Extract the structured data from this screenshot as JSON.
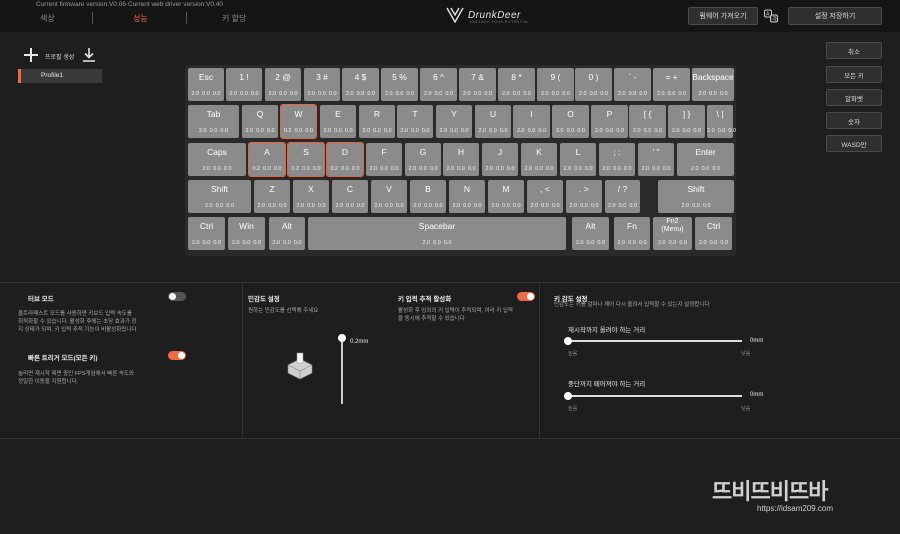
{
  "header": {
    "firmware_version": "Current firmware version:V0.06",
    "driver_version": "Current web driver version:V0.40",
    "tabs": [
      {
        "label": "색상",
        "active": false
      },
      {
        "label": "성능",
        "active": true
      },
      {
        "label": "키 할당",
        "active": false
      }
    ],
    "logo_text": "DrunkDeer",
    "logo_sub": "UNLEASH YOUR POTENTIAL",
    "import_button": "펌웨어 가져오기",
    "save_button": "설정 저장하기",
    "lang_icon": "translate-icon"
  },
  "profiles": {
    "create_label": "프로필 생성",
    "items": [
      "Profile1"
    ]
  },
  "side_buttons": [
    "취소",
    "모든 키",
    "알파벳",
    "숫자",
    "WASD만"
  ],
  "keyboard": {
    "rows": [
      [
        {
          "label": "Esc",
          "value": "2.0  0.0  0.0"
        },
        {
          "label": "1 !",
          "value": "2.0  0.0  0.0"
        },
        {
          "label": "2 @",
          "value": "2.0  0.0  0.0"
        },
        {
          "label": "3 #",
          "value": "2.0  0.0  0.0"
        },
        {
          "label": "4 $",
          "value": "2.0  0.0  0.0"
        },
        {
          "label": "5 %",
          "value": "2.0  0.0  0.0"
        },
        {
          "label": "6 ^",
          "value": "2.0  0.0  0.0"
        },
        {
          "label": "7 &",
          "value": "2.0  0.0  0.0"
        },
        {
          "label": "8 *",
          "value": "2.0  0.0  0.0"
        },
        {
          "label": "9 (",
          "value": "2.0  0.0  0.0"
        },
        {
          "label": "0 )",
          "value": "2.0  0.0  0.0"
        },
        {
          "label": "` -",
          "value": "2.0  0.0  0.0"
        },
        {
          "label": "= +",
          "value": "2.0  0.0  0.0"
        },
        {
          "label": "Backspace",
          "value": "2.0  0.0  0.0"
        }
      ],
      [
        {
          "label": "Tab",
          "value": "2.0  0.0  0.0"
        },
        {
          "label": "Q",
          "value": "2.0  0.0  0.0"
        },
        {
          "label": "W",
          "value": "0.2  0.0  0.0",
          "selected": true
        },
        {
          "label": "E",
          "value": "2.0  0.0  0.0"
        },
        {
          "label": "R",
          "value": "2.0  0.0  0.0"
        },
        {
          "label": "T",
          "value": "2.0  0.0  0.0"
        },
        {
          "label": "Y",
          "value": "2.0  0.0  0.0"
        },
        {
          "label": "U",
          "value": "2.0  0.0  0.0"
        },
        {
          "label": "I",
          "value": "2.0  0.0  0.0"
        },
        {
          "label": "O",
          "value": "2.0  0.0  0.0"
        },
        {
          "label": "P",
          "value": "2.0  0.0  0.0"
        },
        {
          "label": "[ {",
          "value": "2.0  0.0  0.0"
        },
        {
          "label": "] }",
          "value": "2.0  0.0  0.0"
        },
        {
          "label": "\\ |",
          "value": "2.0  0.0  0.0"
        }
      ],
      [
        {
          "label": "Caps",
          "value": "2.0  0.0  0.0"
        },
        {
          "label": "A",
          "value": "0.2  0.0  0.0",
          "selected": true
        },
        {
          "label": "S",
          "value": "0.2  0.0  0.0",
          "selected": true
        },
        {
          "label": "D",
          "value": "0.2  0.0  0.0",
          "selected": true
        },
        {
          "label": "F",
          "value": "2.0  0.0  0.0"
        },
        {
          "label": "G",
          "value": "2.0  0.0  0.0"
        },
        {
          "label": "H",
          "value": "2.0  0.0  0.0"
        },
        {
          "label": "J",
          "value": "2.0  0.0  0.0"
        },
        {
          "label": "K",
          "value": "2.0  0.0  0.0"
        },
        {
          "label": "L",
          "value": "2.0  0.0  0.0"
        },
        {
          "label": "; :",
          "value": "2.0  0.0  0.0"
        },
        {
          "label": "' \"",
          "value": "2.0  0.0  0.0"
        },
        {
          "label": "Enter",
          "value": "2.0  0.0  0.0"
        }
      ],
      [
        {
          "label": "Shift",
          "value": "2.0  0.0  0.0"
        },
        {
          "label": "Z",
          "value": "2.0  0.0  0.0"
        },
        {
          "label": "X",
          "value": "2.0  0.0  0.0"
        },
        {
          "label": "C",
          "value": "2.0  0.0  0.0"
        },
        {
          "label": "V",
          "value": "2.0  0.0  0.0"
        },
        {
          "label": "B",
          "value": "2.0  0.0  0.0"
        },
        {
          "label": "N",
          "value": "2.0  0.0  0.0"
        },
        {
          "label": "M",
          "value": "2.0  0.0  0.0"
        },
        {
          "label": ", <",
          "value": "2.0  0.0  0.0"
        },
        {
          "label": ". >",
          "value": "2.0  0.0  0.0"
        },
        {
          "label": "/ ?",
          "value": "2.0  0.0  0.0"
        },
        {
          "label": "Shift",
          "value": "2.0  0.0  0.0"
        }
      ],
      [
        {
          "label": "Ctrl",
          "value": "2.0  0.0  0.0"
        },
        {
          "label": "Win",
          "value": "2.0  0.0  0.0"
        },
        {
          "label": "Alt",
          "value": "2.0  0.0  0.0"
        },
        {
          "label": "Spacebar",
          "value": "2.0  0.0  0.0"
        },
        {
          "label": "Alt",
          "value": "2.0  0.0  0.0"
        },
        {
          "label": "Fn",
          "value": "2.0  0.0  0.0"
        },
        {
          "label": "Fn2\n(Menu)",
          "value": "2.0  0.0  0.0"
        },
        {
          "label": "Ctrl",
          "value": "2.0  0.0  0.0"
        }
      ]
    ]
  },
  "turbo": {
    "title": "터보 모드",
    "enabled": false,
    "desc1": "울트라패스트 모드를 사용하면 키보드 입력 속도를",
    "desc2": "최적화할 수 있습니다. 활성화 후에는 초당 효과가 정",
    "desc3": "지 상태가 되며, 키 입력 추적 기능이 비활성화됩니다"
  },
  "rapid_trigger": {
    "title": "빠른 트리거 모드(모든 키)",
    "enabled": true,
    "desc1": "눌리면 재시작 제면 중인 FPS게임에서 빠른 속도와",
    "desc2": "정밀한 이동을 지원합니다."
  },
  "sensitivity": {
    "title": "민감도 설정",
    "desc": "원하는 민감도를 선택해 주세요",
    "value_label": "0.2mm"
  },
  "key_tracking": {
    "title": "키 입력 추적 활성화",
    "enabled": true,
    "desc1": "활성화 후 임의의 키 입력이 추적되며, 여러 키 입력",
    "desc2": "을 동시에 추적할 수 있습니다"
  },
  "key_sensitivity": {
    "title": "키 감도 설정",
    "desc": "민감도는 키를 얼마나 깨어 다시 올려서 입력할 수 있는지 설정합니다",
    "reset_title": "재시작까지 올려야 하는 거리",
    "reset_value": "0mm",
    "reset_low": "높음",
    "reset_high": "낮음",
    "release_title": "중단까지 떼어져야 하는 거리",
    "release_value": "0mm",
    "release_low": "높음",
    "release_high": "낮음"
  },
  "watermark": {
    "text": "뜨비뜨비뜨바",
    "url": "https://idsam209.com"
  }
}
